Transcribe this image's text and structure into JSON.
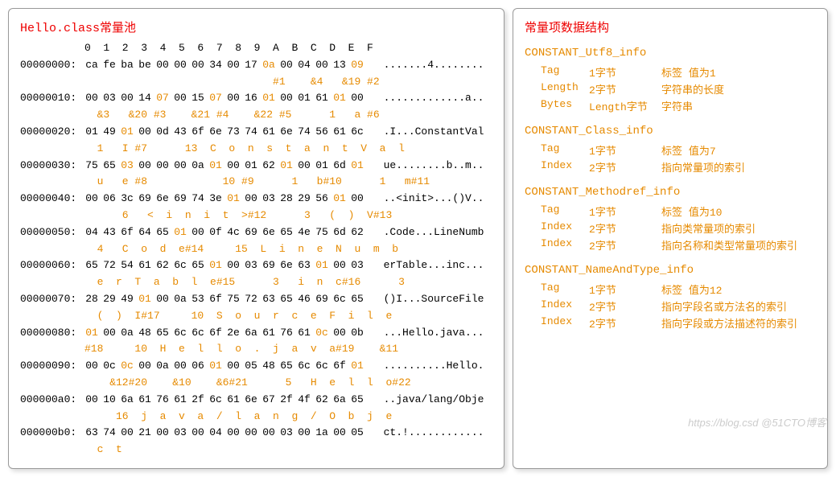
{
  "left": {
    "title": "Hello.class常量池",
    "header": "0  1  2  3  4  5  6  7  8  9  A  B  C  D  E  F",
    "rows": [
      {
        "addr": "00000000:",
        "bytes": [
          {
            "v": "ca"
          },
          {
            "v": "fe"
          },
          {
            "v": "ba"
          },
          {
            "v": "be"
          },
          {
            "v": "00"
          },
          {
            "v": "00"
          },
          {
            "v": "00"
          },
          {
            "v": "34"
          },
          {
            "v": "00"
          },
          {
            "v": "17"
          },
          {
            "v": "0a",
            "o": 1
          },
          {
            "v": "00"
          },
          {
            "v": "04"
          },
          {
            "v": "00"
          },
          {
            "v": "13"
          },
          {
            "v": "09",
            "o": 1
          }
        ],
        "asc": ".......4........",
        "anno": "                              #1    &4   &19 #2"
      },
      {
        "addr": "00000010:",
        "bytes": [
          {
            "v": "00"
          },
          {
            "v": "03"
          },
          {
            "v": "00"
          },
          {
            "v": "14"
          },
          {
            "v": "07",
            "o": 1
          },
          {
            "v": "00"
          },
          {
            "v": "15"
          },
          {
            "v": "07",
            "o": 1
          },
          {
            "v": "00"
          },
          {
            "v": "16"
          },
          {
            "v": "01",
            "o": 1
          },
          {
            "v": "00"
          },
          {
            "v": "01"
          },
          {
            "v": "61"
          },
          {
            "v": "01",
            "o": 1
          },
          {
            "v": "00"
          }
        ],
        "asc": ".............a..",
        "anno": "  &3   &20 #3    &21 #4    &22 #5      1   a #6"
      },
      {
        "addr": "00000020:",
        "bytes": [
          {
            "v": "01"
          },
          {
            "v": "49"
          },
          {
            "v": "01",
            "o": 1
          },
          {
            "v": "00"
          },
          {
            "v": "0d"
          },
          {
            "v": "43"
          },
          {
            "v": "6f"
          },
          {
            "v": "6e"
          },
          {
            "v": "73"
          },
          {
            "v": "74"
          },
          {
            "v": "61"
          },
          {
            "v": "6e"
          },
          {
            "v": "74"
          },
          {
            "v": "56"
          },
          {
            "v": "61"
          },
          {
            "v": "6c"
          }
        ],
        "asc": ".I...ConstantVal",
        "anno": "  1   I #7      13  C  o  n  s  t  a  n  t  V  a  l"
      },
      {
        "addr": "00000030:",
        "bytes": [
          {
            "v": "75"
          },
          {
            "v": "65"
          },
          {
            "v": "03",
            "o": 1
          },
          {
            "v": "00"
          },
          {
            "v": "00"
          },
          {
            "v": "00"
          },
          {
            "v": "0a"
          },
          {
            "v": "01",
            "o": 1
          },
          {
            "v": "00"
          },
          {
            "v": "01"
          },
          {
            "v": "62"
          },
          {
            "v": "01",
            "o": 1
          },
          {
            "v": "00"
          },
          {
            "v": "01"
          },
          {
            "v": "6d"
          },
          {
            "v": "01",
            "o": 1
          }
        ],
        "asc": "ue........b..m..",
        "anno": "  u   e #8            10 #9      1   b#10      1   m#11"
      },
      {
        "addr": "00000040:",
        "bytes": [
          {
            "v": "00"
          },
          {
            "v": "06"
          },
          {
            "v": "3c"
          },
          {
            "v": "69"
          },
          {
            "v": "6e"
          },
          {
            "v": "69"
          },
          {
            "v": "74"
          },
          {
            "v": "3e"
          },
          {
            "v": "01",
            "o": 1
          },
          {
            "v": "00"
          },
          {
            "v": "03"
          },
          {
            "v": "28"
          },
          {
            "v": "29"
          },
          {
            "v": "56"
          },
          {
            "v": "01",
            "o": 1
          },
          {
            "v": "00"
          }
        ],
        "asc": "..<init>...()V..",
        "anno": "      6   <  i  n  i  t  >#12      3   (  )  V#13"
      },
      {
        "addr": "00000050:",
        "bytes": [
          {
            "v": "04"
          },
          {
            "v": "43"
          },
          {
            "v": "6f"
          },
          {
            "v": "64"
          },
          {
            "v": "65"
          },
          {
            "v": "01",
            "o": 1
          },
          {
            "v": "00"
          },
          {
            "v": "0f"
          },
          {
            "v": "4c"
          },
          {
            "v": "69"
          },
          {
            "v": "6e"
          },
          {
            "v": "65"
          },
          {
            "v": "4e"
          },
          {
            "v": "75"
          },
          {
            "v": "6d"
          },
          {
            "v": "62"
          }
        ],
        "asc": ".Code...LineNumb",
        "anno": "  4   C  o  d  e#14     15  L  i  n  e  N  u  m  b"
      },
      {
        "addr": "00000060:",
        "bytes": [
          {
            "v": "65"
          },
          {
            "v": "72"
          },
          {
            "v": "54"
          },
          {
            "v": "61"
          },
          {
            "v": "62"
          },
          {
            "v": "6c"
          },
          {
            "v": "65"
          },
          {
            "v": "01",
            "o": 1
          },
          {
            "v": "00"
          },
          {
            "v": "03"
          },
          {
            "v": "69"
          },
          {
            "v": "6e"
          },
          {
            "v": "63"
          },
          {
            "v": "01",
            "o": 1
          },
          {
            "v": "00"
          },
          {
            "v": "03"
          }
        ],
        "asc": "erTable...inc...",
        "anno": "  e  r  T  a  b  l  e#15      3   i  n  c#16      3"
      },
      {
        "addr": "00000070:",
        "bytes": [
          {
            "v": "28"
          },
          {
            "v": "29"
          },
          {
            "v": "49"
          },
          {
            "v": "01",
            "o": 1
          },
          {
            "v": "00"
          },
          {
            "v": "0a"
          },
          {
            "v": "53"
          },
          {
            "v": "6f"
          },
          {
            "v": "75"
          },
          {
            "v": "72"
          },
          {
            "v": "63"
          },
          {
            "v": "65"
          },
          {
            "v": "46"
          },
          {
            "v": "69"
          },
          {
            "v": "6c"
          },
          {
            "v": "65"
          }
        ],
        "asc": "()I...SourceFile",
        "anno": "  (  )  I#17     10  S  o  u  r  c  e  F  i  l  e"
      },
      {
        "addr": "00000080:",
        "bytes": [
          {
            "v": "01",
            "o": 1
          },
          {
            "v": "00"
          },
          {
            "v": "0a"
          },
          {
            "v": "48"
          },
          {
            "v": "65"
          },
          {
            "v": "6c"
          },
          {
            "v": "6c"
          },
          {
            "v": "6f"
          },
          {
            "v": "2e"
          },
          {
            "v": "6a"
          },
          {
            "v": "61"
          },
          {
            "v": "76"
          },
          {
            "v": "61"
          },
          {
            "v": "0c",
            "o": 1
          },
          {
            "v": "00"
          },
          {
            "v": "0b"
          }
        ],
        "asc": "...Hello.java...",
        "anno": "#18     10  H  e  l  l  o  .  j  a  v  a#19    &11"
      },
      {
        "addr": "00000090:",
        "bytes": [
          {
            "v": "00"
          },
          {
            "v": "0c"
          },
          {
            "v": "0c",
            "o": 1
          },
          {
            "v": "00"
          },
          {
            "v": "0a"
          },
          {
            "v": "00"
          },
          {
            "v": "06"
          },
          {
            "v": "01",
            "o": 1
          },
          {
            "v": "00"
          },
          {
            "v": "05"
          },
          {
            "v": "48"
          },
          {
            "v": "65"
          },
          {
            "v": "6c"
          },
          {
            "v": "6c"
          },
          {
            "v": "6f"
          },
          {
            "v": "01",
            "o": 1
          }
        ],
        "asc": "..........Hello.",
        "anno": "    &12#20    &10    &6#21      5   H  e  l  l  o#22"
      },
      {
        "addr": "000000a0:",
        "bytes": [
          {
            "v": "00"
          },
          {
            "v": "10"
          },
          {
            "v": "6a"
          },
          {
            "v": "61"
          },
          {
            "v": "76"
          },
          {
            "v": "61"
          },
          {
            "v": "2f"
          },
          {
            "v": "6c"
          },
          {
            "v": "61"
          },
          {
            "v": "6e"
          },
          {
            "v": "67"
          },
          {
            "v": "2f"
          },
          {
            "v": "4f"
          },
          {
            "v": "62"
          },
          {
            "v": "6a"
          },
          {
            "v": "65"
          }
        ],
        "asc": "..java/lang/Obje",
        "anno": "     16  j  a  v  a  /  l  a  n  g  /  O  b  j  e"
      },
      {
        "addr": "000000b0:",
        "bytes": [
          {
            "v": "63"
          },
          {
            "v": "74"
          },
          {
            "v": "00"
          },
          {
            "v": "21"
          },
          {
            "v": "00"
          },
          {
            "v": "03"
          },
          {
            "v": "00"
          },
          {
            "v": "04"
          },
          {
            "v": "00"
          },
          {
            "v": "00"
          },
          {
            "v": "00"
          },
          {
            "v": "03"
          },
          {
            "v": "00"
          },
          {
            "v": "1a"
          },
          {
            "v": "00"
          },
          {
            "v": "05"
          }
        ],
        "asc": "ct.!............",
        "anno": "  c  t"
      }
    ]
  },
  "right": {
    "title": "常量项数据结构",
    "sections": [
      {
        "name": "CONSTANT_Utf8_info",
        "rows": [
          {
            "label": "Tag",
            "size": "1字节",
            "desc": "标签 值为1"
          },
          {
            "label": "Length",
            "size": "2字节",
            "desc": "字符串的长度"
          },
          {
            "label": "Bytes",
            "size": "Length字节",
            "desc": "字符串"
          }
        ]
      },
      {
        "name": "CONSTANT_Class_info",
        "rows": [
          {
            "label": "Tag",
            "size": "1字节",
            "desc": "标签 值为7"
          },
          {
            "label": "Index",
            "size": "2字节",
            "desc": "指向常量项的索引"
          }
        ]
      },
      {
        "name": "CONSTANT_Methodref_info",
        "rows": [
          {
            "label": "Tag",
            "size": "1字节",
            "desc": "标签 值为10"
          },
          {
            "label": "Index",
            "size": "2字节",
            "desc": "指向类常量项的索引"
          },
          {
            "label": "Index",
            "size": "2字节",
            "desc": "指向名称和类型常量项的索引"
          }
        ]
      },
      {
        "name": "CONSTANT_NameAndType_info",
        "rows": [
          {
            "label": "Tag",
            "size": "1字节",
            "desc": "标签 值为12"
          },
          {
            "label": "Index",
            "size": "2字节",
            "desc": "指向字段名或方法名的索引"
          },
          {
            "label": "Index",
            "size": "2字节",
            "desc": "指向字段或方法描述符的索引"
          }
        ]
      }
    ]
  },
  "watermark": "https://blog.csd @51CTO博客"
}
